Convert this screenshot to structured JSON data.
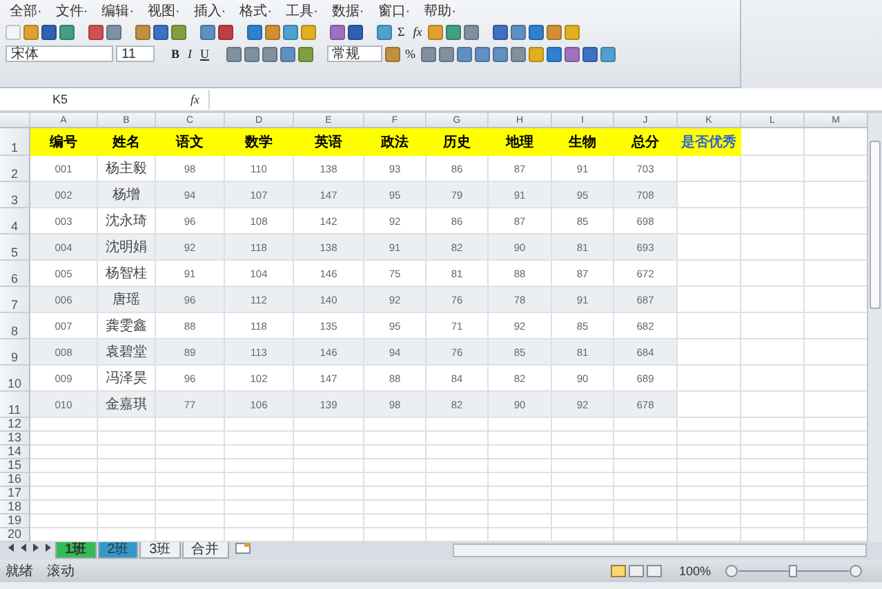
{
  "menu": [
    "全部·",
    "文件·",
    "编辑·",
    "视图·",
    "插入·",
    "格式·",
    "工具·",
    "数据·",
    "窗口·",
    "帮助·"
  ],
  "toolbar": {
    "font": "宋体",
    "size": "11",
    "bold": "B",
    "italic": "I",
    "underline": "U",
    "number_format": "常规",
    "sum": "Σ",
    "function": "fx",
    "percent": "%"
  },
  "name_box": "K5",
  "formula_label": "fx",
  "columns": [
    "A",
    "B",
    "C",
    "D",
    "E",
    "F",
    "G",
    "H",
    "I",
    "J",
    "K",
    "L",
    "M"
  ],
  "row_numbers": [
    "1",
    "2",
    "3",
    "4",
    "5",
    "6",
    "7",
    "8",
    "9",
    "10",
    "11",
    "12",
    "13",
    "14",
    "15",
    "16",
    "17",
    "18",
    "19",
    "20"
  ],
  "header_row": [
    {
      "text": "编号",
      "kind": "field"
    },
    {
      "text": "姓名",
      "kind": "field"
    },
    {
      "text": "语文",
      "kind": "field"
    },
    {
      "text": "数学",
      "kind": "field"
    },
    {
      "text": "英语",
      "kind": "field"
    },
    {
      "text": "政法",
      "kind": "field"
    },
    {
      "text": "历史",
      "kind": "field"
    },
    {
      "text": "地理",
      "kind": "field"
    },
    {
      "text": "生物",
      "kind": "field"
    },
    {
      "text": "总分",
      "kind": "field"
    },
    {
      "text": "是否优秀",
      "kind": "flag"
    }
  ],
  "data_rows": [
    [
      "001",
      "杨主毅",
      "98",
      "110",
      "138",
      "93",
      "86",
      "87",
      "91",
      "703"
    ],
    [
      "002",
      "杨增",
      "94",
      "107",
      "147",
      "95",
      "79",
      "91",
      "95",
      "708"
    ],
    [
      "003",
      "沈永琦",
      "96",
      "108",
      "142",
      "92",
      "86",
      "87",
      "85",
      "698"
    ],
    [
      "004",
      "沈明娟",
      "92",
      "118",
      "138",
      "91",
      "82",
      "90",
      "81",
      "693"
    ],
    [
      "005",
      "杨智桂",
      "91",
      "104",
      "146",
      "75",
      "81",
      "88",
      "87",
      "672"
    ],
    [
      "006",
      "唐瑶",
      "96",
      "112",
      "140",
      "92",
      "76",
      "78",
      "91",
      "687"
    ],
    [
      "007",
      "龚雯鑫",
      "88",
      "118",
      "135",
      "95",
      "71",
      "92",
      "85",
      "682"
    ],
    [
      "008",
      "袁碧堂",
      "89",
      "113",
      "146",
      "94",
      "76",
      "85",
      "81",
      "684"
    ],
    [
      "009",
      "冯泽昊",
      "96",
      "102",
      "147",
      "88",
      "84",
      "82",
      "90",
      "689"
    ],
    [
      "010",
      "金嘉琪",
      "77",
      "106",
      "139",
      "98",
      "82",
      "90",
      "92",
      "678"
    ]
  ],
  "sheet_tabs": [
    {
      "label": "1班",
      "selected": true,
      "color": "#33bb55"
    },
    {
      "label": "2班",
      "selected": false,
      "color": "#3399cc"
    },
    {
      "label": "3班",
      "selected": false
    },
    {
      "label": "合并",
      "selected": false
    }
  ],
  "status_bar": {
    "items": [
      "就绪",
      "滚动"
    ],
    "zoom": "100%",
    "level": 0.5
  }
}
